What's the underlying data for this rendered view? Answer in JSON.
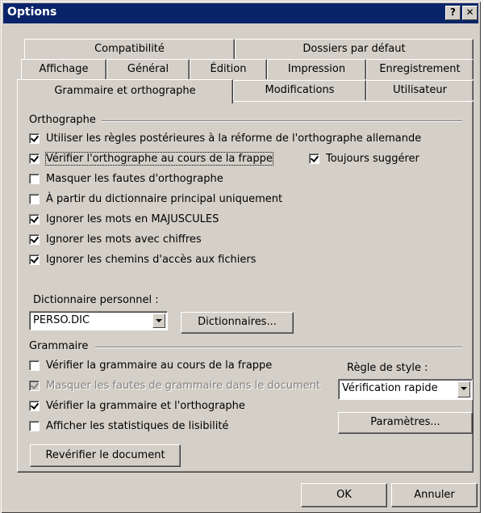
{
  "window": {
    "title": "Options",
    "help_button": "?",
    "close_button": "✕"
  },
  "tabs": {
    "row1": [
      "Compatibilité",
      "Dossiers par défaut"
    ],
    "row2": [
      "Affichage",
      "Général",
      "Édition",
      "Impression",
      "Enregistrement"
    ],
    "row3": [
      "Grammaire et orthographe",
      "Modifications",
      "Utilisateur"
    ]
  },
  "orthographe": {
    "group_label": "Orthographe",
    "options": [
      {
        "label": "Utiliser les règles postérieures à la réforme de l'orthographe allemande",
        "checked": true
      },
      {
        "label": "Vérifier l'orthographe au cours de la frappe",
        "checked": true
      },
      {
        "label": "Masquer les fautes d'orthographe",
        "checked": false
      },
      {
        "label": "À partir du dictionnaire principal uniquement",
        "checked": false
      },
      {
        "label": "Ignorer les mots en MAJUSCULES",
        "checked": true
      },
      {
        "label": "Ignorer les mots avec chiffres",
        "checked": true
      },
      {
        "label": "Ignorer les chemins d'accès aux fichiers",
        "checked": true
      }
    ],
    "toujours_suggerer": {
      "label": "Toujours suggérer",
      "checked": true
    },
    "dictionnaire_label": "Dictionnaire personnel :",
    "dictionnaire_value": "PERSO.DIC",
    "dictionnaires_button": "Dictionnaires..."
  },
  "grammaire": {
    "group_label": "Grammaire",
    "options": [
      {
        "label": "Vérifier la grammaire au cours de la frappe",
        "checked": false,
        "disabled": false
      },
      {
        "label": "Masquer les fautes de grammaire dans le document",
        "checked": true,
        "disabled": true
      },
      {
        "label": "Vérifier la grammaire et l'orthographe",
        "checked": true,
        "disabled": false
      },
      {
        "label": "Afficher les statistiques de lisibilité",
        "checked": false,
        "disabled": false
      }
    ],
    "regle_label": "Règle de style :",
    "regle_value": "Vérification rapide",
    "parametres_button": "Paramètres...",
    "reverifier_button": "Revérifier le document"
  },
  "footer": {
    "ok_button": "OK",
    "cancel_button": "Annuler"
  }
}
